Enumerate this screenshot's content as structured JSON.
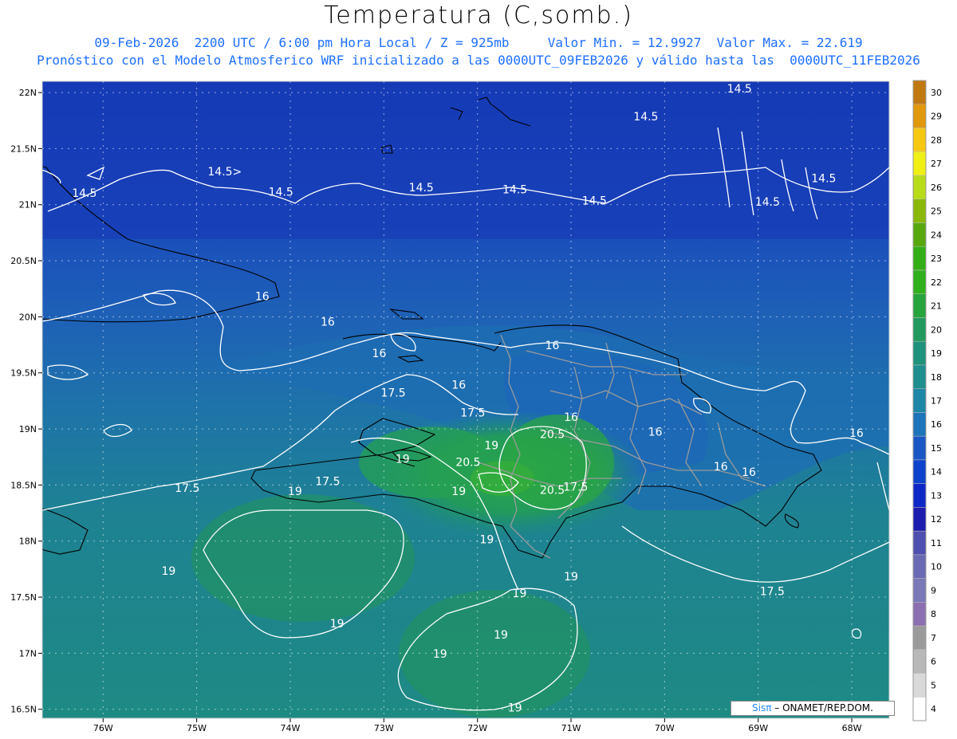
{
  "title": "Temperatura (C,somb.)",
  "subtitle_line1": "09-Feb-2026  2200 UTC / 6:00 pm Hora Local / Z = 925mb     Valor Min. = 12.9927  Valor Max. = 22.619",
  "subtitle_line2": "Pronóstico con el Modelo Atmosferico WRF inicializado a las 0000UTC_09FEB2026 y válido hasta las  0000UTC_11FEB2026",
  "credit": {
    "brand": "Sisπ",
    "text": " – ONAMET/REP.DOM."
  },
  "axes": {
    "lat_labels": [
      "22N",
      "21.5N",
      "21N",
      "20.5N",
      "20N",
      "19.5N",
      "19N",
      "18.5N",
      "18N",
      "17.5N",
      "17N",
      "16.5N"
    ],
    "lat_values": [
      22,
      21.5,
      21,
      20.5,
      20,
      19.5,
      19,
      18.5,
      18,
      17.5,
      17,
      16.5
    ],
    "lon_labels": [
      "76W",
      "75W",
      "74W",
      "73W",
      "72W",
      "71W",
      "70W",
      "69W",
      "68W"
    ],
    "lon_values": [
      -76,
      -75,
      -74,
      -73,
      -72,
      -71,
      -70,
      -69,
      -68
    ],
    "lat_range": [
      16.42,
      22.1
    ],
    "lon_range": [
      -76.65,
      -67.6
    ],
    "grid": "dotted"
  },
  "colorbar": {
    "labels": [
      "4",
      "5",
      "6",
      "7",
      "8",
      "9",
      "10",
      "11",
      "12",
      "13",
      "14",
      "15",
      "16",
      "17",
      "18",
      "19",
      "20",
      "21",
      "22",
      "23",
      "24",
      "25",
      "26",
      "27",
      "28",
      "29",
      "30"
    ],
    "colors": [
      "#ffffff",
      "#d9d9d9",
      "#b8b8b8",
      "#9a9a9a",
      "#8c6fb0",
      "#7a78b6",
      "#6a6ab4",
      "#4f4fb0",
      "#1c1cae",
      "#0e28c8",
      "#0c42cc",
      "#1957c4",
      "#1e74b8",
      "#1e86a6",
      "#1e8e8e",
      "#1e927a",
      "#229a5e",
      "#28a43c",
      "#30b01c",
      "#34ae16",
      "#56a80e",
      "#8ab80a",
      "#b8dc18",
      "#f0f014",
      "#f6c812",
      "#e0980c",
      "#c07810"
    ]
  },
  "field": {
    "min": 12.9927,
    "max": 22.619,
    "contour_labels": [
      {
        "text": "14.5",
        "lat": 21.07,
        "lon": -76.2
      },
      {
        "text": "14.5>",
        "lat": 21.26,
        "lon": -74.7
      },
      {
        "text": "14.5",
        "lat": 21.08,
        "lon": -74.1
      },
      {
        "text": "14.5",
        "lat": 21.12,
        "lon": -72.6
      },
      {
        "text": "14.5",
        "lat": 21.1,
        "lon": -71.6
      },
      {
        "text": "14.5",
        "lat": 21.0,
        "lon": -70.75
      },
      {
        "text": "14.5",
        "lat": 21.75,
        "lon": -70.2
      },
      {
        "text": "14.5",
        "lat": 22.0,
        "lon": -69.2
      },
      {
        "text": "14.5",
        "lat": 21.2,
        "lon": -68.3
      },
      {
        "text": "14.5",
        "lat": 20.99,
        "lon": -68.9
      },
      {
        "text": "16",
        "lat": 20.15,
        "lon": -74.3
      },
      {
        "text": "16",
        "lat": 19.92,
        "lon": -73.6
      },
      {
        "text": "16",
        "lat": 19.64,
        "lon": -73.05
      },
      {
        "text": "16",
        "lat": 19.71,
        "lon": -71.2
      },
      {
        "text": "16",
        "lat": 19.36,
        "lon": -72.2
      },
      {
        "text": "16",
        "lat": 19.07,
        "lon": -71.0
      },
      {
        "text": "16",
        "lat": 18.94,
        "lon": -70.1
      },
      {
        "text": "16",
        "lat": 18.63,
        "lon": -69.4
      },
      {
        "text": "16",
        "lat": 18.58,
        "lon": -69.1
      },
      {
        "text": "16",
        "lat": 18.93,
        "lon": -67.95
      },
      {
        "text": "17.5",
        "lat": 19.29,
        "lon": -72.9
      },
      {
        "text": "17.5",
        "lat": 19.11,
        "lon": -72.05
      },
      {
        "text": "17.5",
        "lat": 18.44,
        "lon": -75.1
      },
      {
        "text": "17.5",
        "lat": 18.5,
        "lon": -73.6
      },
      {
        "text": "17.5",
        "lat": 18.45,
        "lon": -70.95
      },
      {
        "text": "17.5",
        "lat": 17.52,
        "lon": -68.85
      },
      {
        "text": "19",
        "lat": 18.7,
        "lon": -72.8
      },
      {
        "text": "19",
        "lat": 18.41,
        "lon": -73.95
      },
      {
        "text": "19",
        "lat": 18.41,
        "lon": -72.2
      },
      {
        "text": "19",
        "lat": 18.82,
        "lon": -71.85
      },
      {
        "text": "19",
        "lat": 17.98,
        "lon": -71.9
      },
      {
        "text": "19",
        "lat": 17.7,
        "lon": -75.3
      },
      {
        "text": "19",
        "lat": 17.65,
        "lon": -71.0
      },
      {
        "text": "19",
        "lat": 17.5,
        "lon": -71.55
      },
      {
        "text": "19",
        "lat": 17.23,
        "lon": -73.5
      },
      {
        "text": "19",
        "lat": 17.13,
        "lon": -71.75
      },
      {
        "text": "19",
        "lat": 16.96,
        "lon": -72.4
      },
      {
        "text": "19",
        "lat": 16.48,
        "lon": -71.6
      },
      {
        "text": "20.5",
        "lat": 18.92,
        "lon": -71.2
      },
      {
        "text": "20.5",
        "lat": 18.67,
        "lon": -72.1
      },
      {
        "text": "20.5",
        "lat": 18.42,
        "lon": -71.2
      }
    ]
  }
}
